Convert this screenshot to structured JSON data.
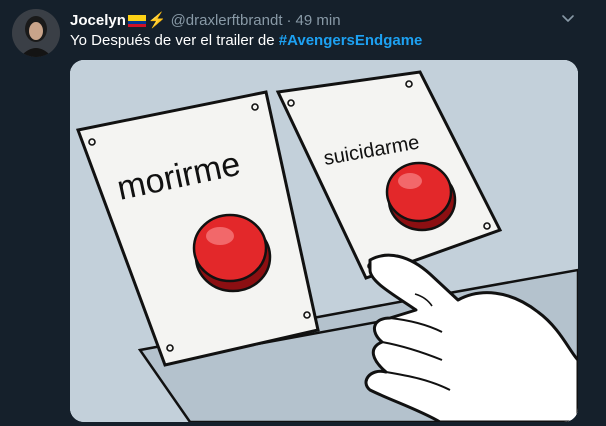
{
  "tweet": {
    "author_name": "Jocelyn",
    "handle": "@draxlerftbrandt",
    "separator": "·",
    "time": "49 min",
    "text_prefix": "Yo Después de ver el trailer de ",
    "hashtag": "#AvengersEndgame",
    "badges": [
      "colombia-flag",
      "lightning-bolt"
    ],
    "colors": {
      "background": "#15202b",
      "secondary_text": "#8899a6",
      "link": "#1da1f2"
    }
  },
  "meme": {
    "left_button_label": "morirme",
    "right_button_label": "suicidarme"
  }
}
